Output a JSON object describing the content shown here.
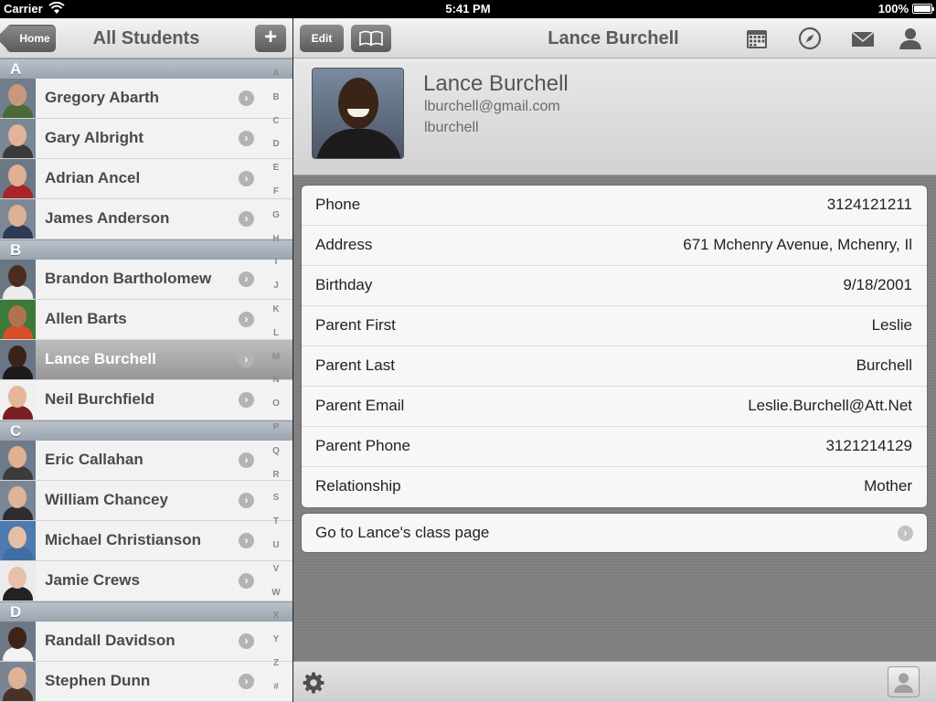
{
  "status_bar": {
    "carrier": "Carrier",
    "time": "5:41 PM",
    "battery": "100%"
  },
  "left_nav": {
    "back_label": "Home",
    "title": "All Students",
    "add_label": "+"
  },
  "sections": [
    {
      "letter": "A",
      "students": [
        {
          "name": "Gregory Abarth",
          "skin": "#c9987a",
          "shirt": "#4a6a3a",
          "bg": "#6f7d8c"
        },
        {
          "name": "Gary Albright",
          "skin": "#e2b39a",
          "shirt": "#3b3b3b",
          "bg": "#7a8794"
        },
        {
          "name": "Adrian Ancel",
          "skin": "#e0b092",
          "shirt": "#a8252b",
          "bg": "#6c7886"
        },
        {
          "name": "James Anderson",
          "skin": "#dcb196",
          "shirt": "#2f3a57",
          "bg": "#7c8896"
        }
      ]
    },
    {
      "letter": "B",
      "students": [
        {
          "name": "Brandon Bartholomew",
          "skin": "#4a2d1e",
          "shirt": "#ececec",
          "bg": "#6b7685"
        },
        {
          "name": "Allen Barts",
          "skin": "#b07350",
          "shirt": "#d84d2a",
          "bg": "#3c7a3a"
        },
        {
          "name": "Lance Burchell",
          "skin": "#3a2418",
          "shirt": "#1c1a1c",
          "bg": "#6a7688",
          "selected": true
        },
        {
          "name": "Neil Burchfield",
          "skin": "#e3b697",
          "shirt": "#7a1f22",
          "bg": "#f0f0f0"
        }
      ]
    },
    {
      "letter": "C",
      "students": [
        {
          "name": "Eric Callahan",
          "skin": "#e0b093",
          "shirt": "#3c3b3b",
          "bg": "#6f7b8a"
        },
        {
          "name": "William Chancey",
          "skin": "#dfb397",
          "shirt": "#2d2d2d",
          "bg": "#7b8694"
        },
        {
          "name": "Michael Christianson",
          "skin": "#e6bea3",
          "shirt": "#3f6ea5",
          "bg": "#4d7ab0"
        },
        {
          "name": "Jamie Crews",
          "skin": "#e7c0a8",
          "shirt": "#222222",
          "bg": "#ebebeb"
        }
      ]
    },
    {
      "letter": "D",
      "students": [
        {
          "name": "Randall Davidson",
          "skin": "#3d2419",
          "shirt": "#f2f2f2",
          "bg": "#6d7887"
        },
        {
          "name": "Stephen Dunn",
          "skin": "#dfb296",
          "shirt": "#4a3228",
          "bg": "#7a8594"
        }
      ]
    }
  ],
  "index_letters": [
    "A",
    "B",
    "C",
    "D",
    "E",
    "F",
    "G",
    "H",
    "I",
    "J",
    "K",
    "L",
    "M",
    "N",
    "O",
    "P",
    "Q",
    "R",
    "S",
    "T",
    "U",
    "V",
    "W",
    "X",
    "Y",
    "Z",
    "#"
  ],
  "right_nav": {
    "edit_label": "Edit",
    "title": "Lance Burchell"
  },
  "profile": {
    "name": "Lance Burchell",
    "email": "lburchell@gmail.com",
    "username": "lburchell"
  },
  "details": [
    {
      "label": "Phone",
      "value": "3124121211"
    },
    {
      "label": "Address",
      "value": "671 Mchenry Avenue, Mchenry, Il"
    },
    {
      "label": "Birthday",
      "value": "9/18/2001"
    },
    {
      "label": "Parent First",
      "value": "Leslie"
    },
    {
      "label": "Parent Last",
      "value": "Burchell"
    },
    {
      "label": "Parent Email",
      "value": "Leslie.Burchell@Att.Net"
    },
    {
      "label": "Parent Phone",
      "value": "3121214129"
    },
    {
      "label": "Relationship",
      "value": "Mother"
    }
  ],
  "class_page_link": "Go to Lance's class page",
  "icons": {
    "nav": [
      "book-icon",
      "calendar-icon",
      "compass-icon",
      "mail-icon",
      "user-icon"
    ],
    "toolbar": [
      "gear-icon",
      "contact-card-icon"
    ]
  }
}
